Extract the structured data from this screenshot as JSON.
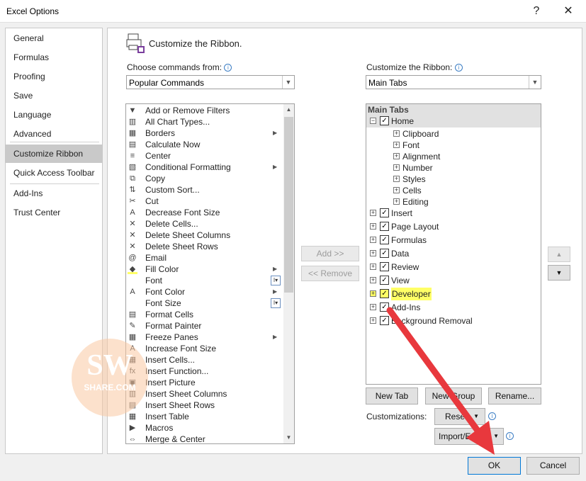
{
  "window": {
    "title": "Excel Options",
    "help_label": "?",
    "close_label": "✕"
  },
  "sidebar": {
    "items": [
      "General",
      "Formulas",
      "Proofing",
      "Save",
      "Language",
      "Advanced",
      "Customize Ribbon",
      "Quick Access Toolbar",
      "Add-Ins",
      "Trust Center"
    ],
    "selected": "Customize Ribbon"
  },
  "main": {
    "heading": "Customize the Ribbon.",
    "choose_label": "Choose commands from:",
    "choose_value": "Popular Commands",
    "customize_label": "Customize the Ribbon:",
    "customize_value": "Main Tabs"
  },
  "commands": [
    {
      "icon": "filter-icon",
      "glyph": "▼",
      "label": "Add or Remove Filters"
    },
    {
      "icon": "chart-icon",
      "glyph": "▥",
      "label": "All Chart Types..."
    },
    {
      "icon": "borders-icon",
      "glyph": "▦",
      "label": "Borders",
      "sub": "▶"
    },
    {
      "icon": "calculator-icon",
      "glyph": "▤",
      "label": "Calculate Now"
    },
    {
      "icon": "center-icon",
      "glyph": "≡",
      "label": "Center"
    },
    {
      "icon": "conditional-formatting-icon",
      "glyph": "▧",
      "label": "Conditional Formatting",
      "sub": "▶"
    },
    {
      "icon": "copy-icon",
      "glyph": "⧉",
      "label": "Copy"
    },
    {
      "icon": "sort-icon",
      "glyph": "⇅",
      "label": "Custom Sort..."
    },
    {
      "icon": "cut-icon",
      "glyph": "✂",
      "label": "Cut"
    },
    {
      "icon": "decrease-font-icon",
      "glyph": "A",
      "label": "Decrease Font Size"
    },
    {
      "icon": "delete-cells-icon",
      "glyph": "✕",
      "label": "Delete Cells..."
    },
    {
      "icon": "delete-columns-icon",
      "glyph": "✕",
      "label": "Delete Sheet Columns"
    },
    {
      "icon": "delete-rows-icon",
      "glyph": "✕",
      "label": "Delete Sheet Rows"
    },
    {
      "icon": "email-icon",
      "glyph": "@",
      "label": "Email"
    },
    {
      "icon": "fill-color-icon",
      "glyph": "◆",
      "label": "Fill Color",
      "sub": "▶"
    },
    {
      "icon": "font-icon",
      "glyph": "",
      "label": "Font",
      "dd": "I▾"
    },
    {
      "icon": "font-color-icon",
      "glyph": "A",
      "label": "Font Color",
      "sub": "▶"
    },
    {
      "icon": "font-size-icon",
      "glyph": "",
      "label": "Font Size",
      "dd": "I▾"
    },
    {
      "icon": "format-cells-icon",
      "glyph": "▤",
      "label": "Format Cells"
    },
    {
      "icon": "format-painter-icon",
      "glyph": "✎",
      "label": "Format Painter"
    },
    {
      "icon": "freeze-panes-icon",
      "glyph": "▦",
      "label": "Freeze Panes",
      "sub": "▶"
    },
    {
      "icon": "increase-font-icon",
      "glyph": "A",
      "label": "Increase Font Size"
    },
    {
      "icon": "insert-cells-icon",
      "glyph": "▦",
      "label": "Insert Cells..."
    },
    {
      "icon": "insert-function-icon",
      "glyph": "fx",
      "label": "Insert Function..."
    },
    {
      "icon": "insert-picture-icon",
      "glyph": "▣",
      "label": "Insert Picture"
    },
    {
      "icon": "insert-columns-icon",
      "glyph": "▥",
      "label": "Insert Sheet Columns"
    },
    {
      "icon": "insert-rows-icon",
      "glyph": "▤",
      "label": "Insert Sheet Rows"
    },
    {
      "icon": "insert-table-icon",
      "glyph": "▦",
      "label": "Insert Table"
    },
    {
      "icon": "macros-icon",
      "glyph": "▶",
      "label": "Macros"
    },
    {
      "icon": "merge-center-icon",
      "glyph": "⇔",
      "label": "Merge & Center"
    }
  ],
  "tree": {
    "header": "Main Tabs",
    "home": "Home",
    "home_groups": [
      "Clipboard",
      "Font",
      "Alignment",
      "Number",
      "Styles",
      "Cells",
      "Editing"
    ],
    "tabs": [
      "Insert",
      "Page Layout",
      "Formulas",
      "Data",
      "Review",
      "View",
      "Developer",
      "Add-Ins",
      "Background Removal"
    ]
  },
  "buttons": {
    "add": "Add >>",
    "remove": "<< Remove",
    "new_tab": "New Tab",
    "new_group": "New Group",
    "rename": "Rename...",
    "customizations_label": "Customizations:",
    "reset": "Reset",
    "import_export": "Import/Export",
    "ok": "OK",
    "cancel": "Cancel",
    "up": "▲",
    "down": "▼"
  },
  "watermark": {
    "top": "SW",
    "bottom": "SHARE.COM"
  },
  "colors": {
    "highlight": "#ffff66",
    "arrow": "#e8383d",
    "selected_nav": "#c9c9c9"
  }
}
